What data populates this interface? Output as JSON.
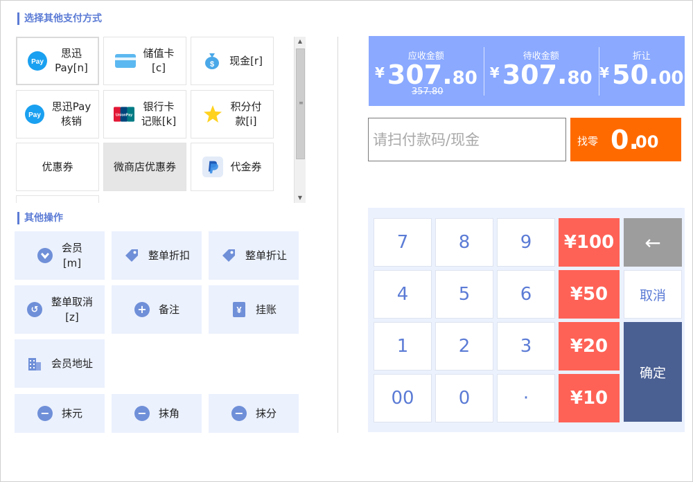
{
  "sections": {
    "pay_title": "选择其他支付方式",
    "ops_title": "其他操作"
  },
  "payments": [
    {
      "label": "思迅\nPay[n]",
      "icon": "siyun-pay-icon"
    },
    {
      "label": "储值卡\n[c]",
      "icon": "stored-card-icon"
    },
    {
      "label": "现金[r]",
      "icon": "cash-bag-icon"
    },
    {
      "label": "思迅Pay\n核销",
      "icon": "siyun-pay-icon"
    },
    {
      "label": "银行卡\n记账[k]",
      "icon": "unionpay-icon"
    },
    {
      "label": "积分付\n款[i]",
      "icon": "star-points-icon"
    },
    {
      "label": "优惠券",
      "icon": ""
    },
    {
      "label": "微商店优惠券",
      "icon": ""
    },
    {
      "label": "代金券",
      "icon": "paypal-voucher-icon"
    }
  ],
  "operations": [
    {
      "label": "会员\n[m]",
      "icon": "member-icon"
    },
    {
      "label": "整单折扣",
      "icon": "tag-icon"
    },
    {
      "label": "整单折让",
      "icon": "tag-icon"
    },
    {
      "label": "整单取消\n[z]",
      "icon": "undo-icon"
    },
    {
      "label": "备注",
      "icon": "plus-circle-icon"
    },
    {
      "label": "挂账",
      "icon": "yen-ledger-icon"
    },
    {
      "label": "会员地址",
      "icon": "building-icon"
    },
    {
      "label": "抹元",
      "icon": "minus-circle-icon"
    },
    {
      "label": "抹角",
      "icon": "minus-circle-icon"
    },
    {
      "label": "抹分",
      "icon": "minus-circle-icon"
    }
  ],
  "totals": {
    "receivable": {
      "label": "应收金额",
      "currency": "¥",
      "int": "307.",
      "dec": "80",
      "original": "357.80"
    },
    "pending": {
      "label": "待收金额",
      "currency": "¥",
      "int": "307.",
      "dec": "80"
    },
    "discount": {
      "label": "折让",
      "currency": "¥",
      "int": "50.",
      "dec": "00"
    }
  },
  "scan": {
    "placeholder": "请扫付款码/现金"
  },
  "change": {
    "label": "找零",
    "int": "0.",
    "dec": "00"
  },
  "keypad": {
    "digits": [
      "7",
      "8",
      "9",
      "4",
      "5",
      "6",
      "1",
      "2",
      "3",
      "00",
      "0",
      "·"
    ],
    "money": [
      "¥100",
      "¥50",
      "¥20",
      "¥10"
    ],
    "back": "←",
    "cancel": "取消",
    "confirm": "确定"
  },
  "colors": {
    "accent": "#5b7bd5",
    "totals_bg": "#8aa9ff",
    "change_bg": "#ff6a00",
    "money_key": "#fe6256",
    "confirm_key": "#4a5f92"
  }
}
